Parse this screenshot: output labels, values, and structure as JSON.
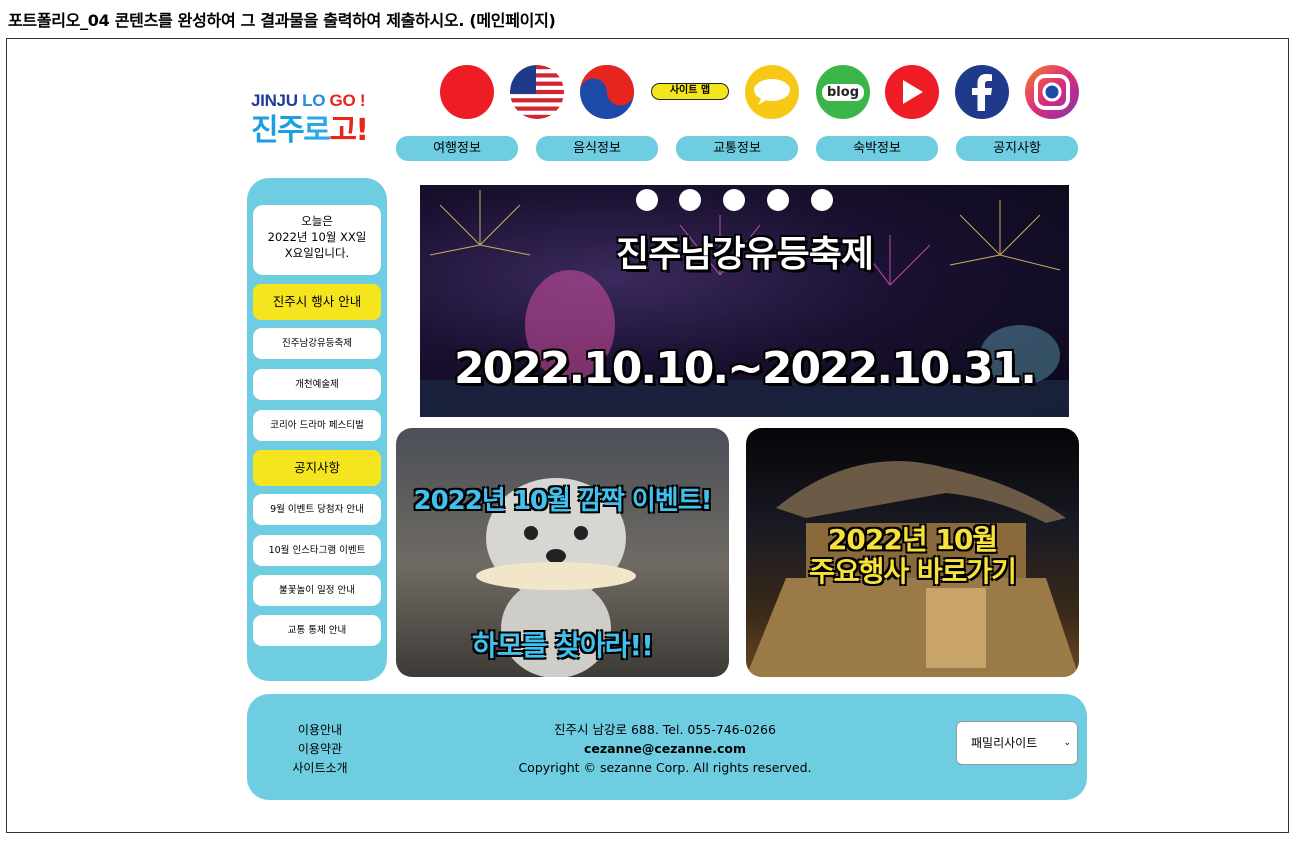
{
  "doc_title": "포트폴리오_04 콘텐츠를 완성하여 그 결과물을 출력하여 제출하시오. (메인페이지)",
  "logo": {
    "line1_a": "JINJU ",
    "line1_b": "LO ",
    "line1_c": "GO !",
    "line2_a": "진주",
    "line2_b": "로",
    "line2_c": "고!"
  },
  "top_icons": [
    "korea-flag-icon",
    "usa-flag-icon",
    "taegeuk-icon",
    "sitemap",
    "speech-bubble-icon",
    "blog-icon",
    "youtube-icon",
    "facebook-icon",
    "instagram-icon"
  ],
  "sitemap_label": "사이트 맵",
  "blog_label": "blog",
  "nav": [
    "여행정보",
    "음식정보",
    "교통정보",
    "숙박정보",
    "공지사항"
  ],
  "sidebar": {
    "date_line1": "오늘은",
    "date_line2": "2022년 10월 XX일",
    "date_line3": "X요일입니다.",
    "events_heading": "진주시 행사 안내",
    "events": [
      "진주남강유등축제",
      "개천예술제",
      "코리아 드라마 페스티벌"
    ],
    "notice_heading": "공지사항",
    "notices": [
      "9월 이벤트 당첨자 안내",
      "10월 인스타그램 이벤트",
      "불꽃놀이 일정 안내",
      "교통 통제 안내"
    ]
  },
  "hero": {
    "title": "진주남강유등축제",
    "dates": "2022.10.10.~2022.10.31.",
    "slides": 5
  },
  "cards": {
    "left_line1": "2022년 10월 깜짝 이벤트!",
    "left_line2": "하모를 찾아라!!",
    "right_line1": "2022년 10월",
    "right_line2": "주요행사 바로가기"
  },
  "footer": {
    "links": [
      "이용안내",
      "이용약관",
      "사이트소개"
    ],
    "address": "진주시 남강로 688. Tel. 055-746-0266",
    "email": "cezanne@cezanne.com",
    "copyright": "Copyright © sezanne Corp. All rights reserved.",
    "family_select": "패밀리사이트"
  },
  "colors": {
    "accent": "#6ecde0",
    "highlight": "#f5e51e"
  }
}
